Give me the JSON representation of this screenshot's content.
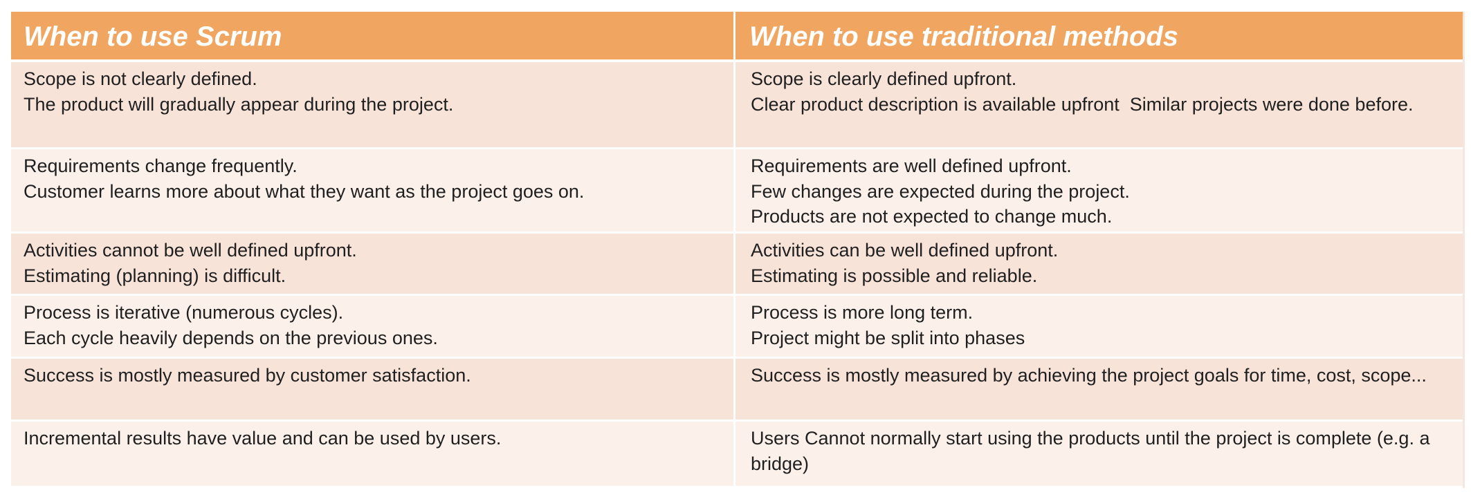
{
  "header": {
    "left": "When  to use Scrum",
    "right": "When to use traditional methods"
  },
  "rows": [
    {
      "left": [
        "Scope is not clearly defined.",
        "The product will gradually appear during the project."
      ],
      "right": [
        "Scope is clearly defined upfront.",
        "Clear product description is available upfront  Similar projects were done before."
      ]
    },
    {
      "left": [
        "Requirements change frequently.",
        "Customer learns more about what they want as the project goes on."
      ],
      "right": [
        "Requirements are well defined upfront.",
        "Few changes are expected during the project.",
        "Products are not expected to change much."
      ]
    },
    {
      "left": [
        "Activities cannot be well defined upfront.",
        "Estimating (planning) is difficult."
      ],
      "right": [
        "Activities can be well defined upfront.",
        "Estimating is possible and reliable."
      ]
    },
    {
      "left": [
        "Process is iterative (numerous cycles).",
        "Each cycle heavily depends on the previous ones."
      ],
      "right": [
        "Process is more long term.",
        "Project might be split into phases"
      ]
    },
    {
      "left": [
        "Success is mostly measured by customer satisfaction."
      ],
      "right": [
        "Success is mostly measured by achieving the project goals for time, cost, scope..."
      ]
    },
    {
      "left": [
        "Incremental results have value and can be used by users."
      ],
      "right": [
        "Users Cannot normally start using the products until the project is complete (e.g. a bridge)"
      ]
    }
  ]
}
